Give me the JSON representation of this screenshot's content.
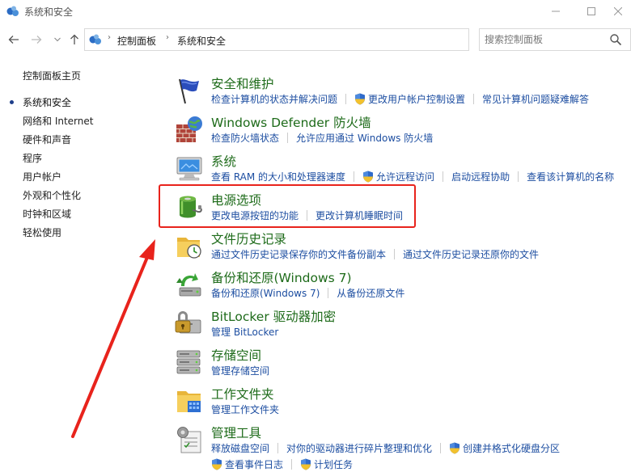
{
  "window": {
    "title": "系统和安全",
    "minimize_icon": "minimize-icon",
    "maximize_icon": "maximize-icon",
    "close_icon": "close-icon"
  },
  "nav": {
    "breadcrumbs": [
      "控制面板",
      "系统和安全"
    ],
    "search_placeholder": "搜索控制面板"
  },
  "sidebar": {
    "home": "控制面板主页",
    "items": [
      {
        "label": "系统和安全",
        "active": true
      },
      {
        "label": "网络和 Internet",
        "active": false
      },
      {
        "label": "硬件和声音",
        "active": false
      },
      {
        "label": "程序",
        "active": false
      },
      {
        "label": "用户帐户",
        "active": false
      },
      {
        "label": "外观和个性化",
        "active": false
      },
      {
        "label": "时钟和区域",
        "active": false
      },
      {
        "label": "轻松使用",
        "active": false
      }
    ]
  },
  "categories": {
    "security": {
      "title": "安全和维护",
      "links": [
        "检查计算机的状态并解决问题",
        "更改用户帐户控制设置",
        "常见计算机问题疑难解答"
      ]
    },
    "firewall": {
      "title": "Windows Defender 防火墙",
      "links": [
        "检查防火墙状态",
        "允许应用通过 Windows 防火墙"
      ]
    },
    "system": {
      "title": "系统",
      "links": [
        "查看 RAM 的大小和处理器速度",
        "允许远程访问",
        "启动远程协助",
        "查看该计算机的名称"
      ]
    },
    "power": {
      "title": "电源选项",
      "links": [
        "更改电源按钮的功能",
        "更改计算机睡眠时间"
      ]
    },
    "filehistory": {
      "title": "文件历史记录",
      "links": [
        "通过文件历史记录保存你的文件备份副本",
        "通过文件历史记录还原你的文件"
      ]
    },
    "backup": {
      "title": "备份和还原(Windows 7)",
      "links": [
        "备份和还原(Windows 7)",
        "从备份还原文件"
      ]
    },
    "bitlocker": {
      "title": "BitLocker 驱动器加密",
      "links": [
        "管理 BitLocker"
      ]
    },
    "storage": {
      "title": "存储空间",
      "links": [
        "管理存储空间"
      ]
    },
    "workfolders": {
      "title": "工作文件夹",
      "links": [
        "管理工作文件夹"
      ]
    },
    "admintools": {
      "title": "管理工具",
      "links": [
        "释放磁盘空间",
        "对你的驱动器进行碎片整理和优化",
        "创建并格式化硬盘分区",
        "查看事件日志",
        "计划任务"
      ]
    }
  },
  "colors": {
    "category_title": "#1e6b1a",
    "link": "#1d4ea1",
    "highlight": "#e8231c"
  }
}
